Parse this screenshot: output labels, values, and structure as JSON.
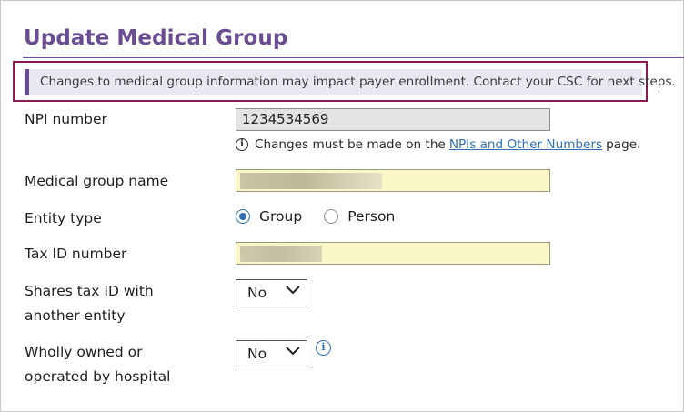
{
  "page": {
    "title": "Update Medical Group",
    "notice": "Changes to medical group information may impact payer enrollment. Contact your CSC for next steps."
  },
  "colors": {
    "accent": "#6a4c93",
    "highlight_border": "#8b1a4e",
    "link": "#2f6fb3",
    "field_fill": "#fbf6c8"
  },
  "form": {
    "npi": {
      "label": "NPI number",
      "value": "1234534569",
      "hint_prefix": "Changes must be made on the",
      "hint_link": "NPIs and Other Numbers",
      "hint_suffix": "page."
    },
    "group_name": {
      "label": "Medical group name",
      "value": ""
    },
    "entity_type": {
      "label": "Entity type",
      "options": [
        "Group",
        "Person"
      ],
      "selected": "Group"
    },
    "tax_id": {
      "label": "Tax ID number",
      "value": ""
    },
    "shares_tax_id": {
      "label_line1": "Shares tax ID with",
      "label_line2": "another entity",
      "selected": "No"
    },
    "hospital_owned": {
      "label_line1": "Wholly owned or",
      "label_line2": "operated by hospital",
      "selected": "No"
    }
  },
  "icons": {
    "hint": "info-icon",
    "select": "chevron-down-icon",
    "help": "info-icon"
  }
}
